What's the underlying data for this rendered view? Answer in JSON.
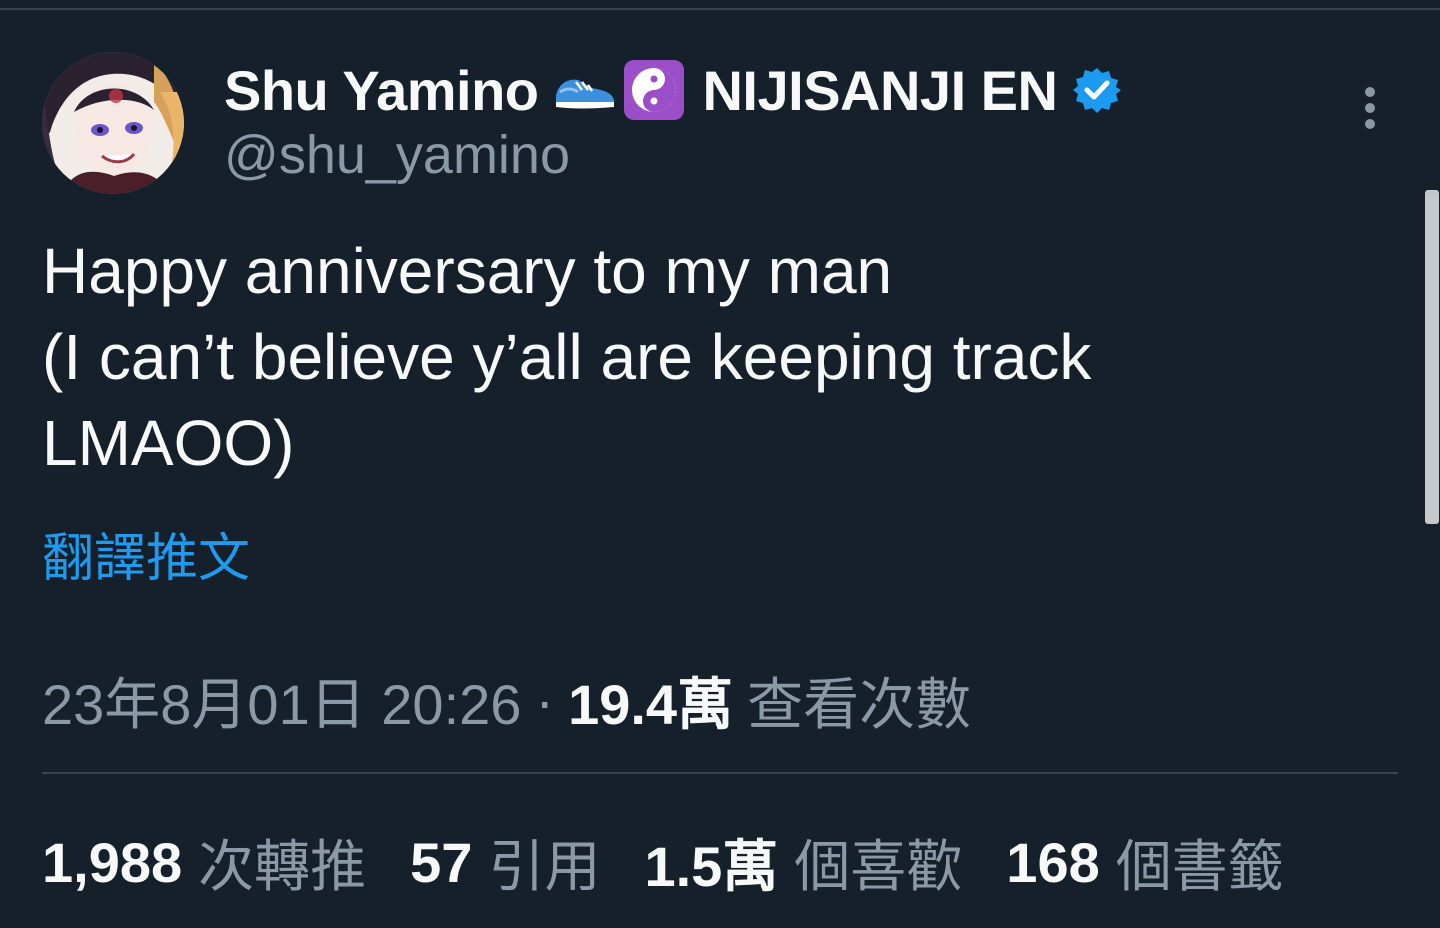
{
  "colors": {
    "background": "#15202b",
    "primary_text": "#f7f9f9",
    "secondary_text": "#8b98a5",
    "link": "#1d9bf0",
    "verified_badge": "#1d9bf0",
    "divider": "#38444d"
  },
  "author": {
    "display_name": "Shu Yamino",
    "emoji_1": "running-shoe",
    "emoji_2": "yin-yang",
    "org_name": "NIJISANJI EN",
    "handle": "@shu_yamino",
    "verified_icon": "verified-badge-icon"
  },
  "more_icon": "more-vertical-icon",
  "tweet": {
    "lines": [
      "Happy anniversary to my man",
      "(I can’t believe y’all are keeping track",
      "LMAOO)"
    ],
    "translate_label": "翻譯推文"
  },
  "meta": {
    "timestamp": "23年8月01日 20:26",
    "separator": "·",
    "views_count": "19.4萬",
    "views_label": "查看次數"
  },
  "stats": {
    "retweets": {
      "count": "1,988",
      "label": "次轉推"
    },
    "quotes": {
      "count": "57",
      "label": "引用"
    },
    "likes": {
      "count": "1.5萬",
      "label": "個喜歡"
    },
    "bookmarks": {
      "count": "168",
      "label": "個書籤"
    }
  }
}
